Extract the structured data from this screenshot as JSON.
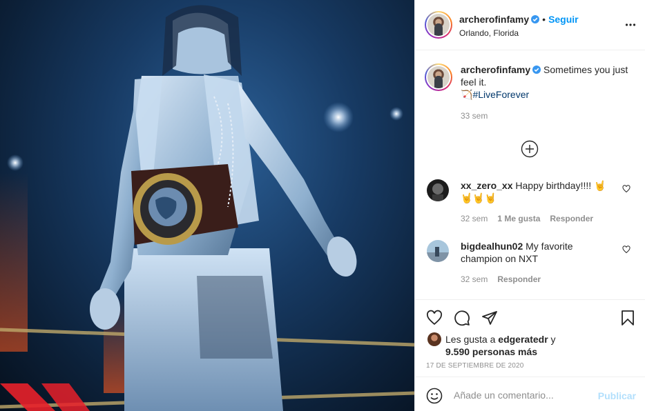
{
  "post": {
    "image_description_icon": "photo-of-wrestler-icon",
    "author": {
      "username": "archerofinfamy",
      "verified_icon": "verified-badge-icon",
      "separator": "•",
      "follow_label": "Seguir",
      "location": "Orlando, Florida"
    },
    "caption": {
      "username": "archerofinfamy",
      "text": "Sometimes you just feel it.",
      "emoji": "🏹",
      "hashtag": "#LiveForever",
      "time": "33 sem"
    },
    "comments": [
      {
        "username": "xx_zero_xx",
        "text": "Happy birthday!!!! 🤘🤘🤘🤘",
        "time": "32 sem",
        "likes": "1 Me gusta",
        "reply": "Responder"
      },
      {
        "username": "bigdealhun02",
        "text": "My favorite champion on NXT",
        "time": "32 sem",
        "reply": "Responder"
      }
    ],
    "likes": {
      "prefix": "Les gusta a",
      "user": "edgeratedr",
      "conjunction": "y",
      "others": "9.590 personas más"
    },
    "date": "17 de septiembre de 2020",
    "add_comment": {
      "placeholder": "Añade un comentario...",
      "publish_label": "Publicar"
    }
  },
  "colors": {
    "accent": "#0095f6",
    "publish_disabled": "#b2dffc",
    "text": "#262626",
    "muted": "#8e8e8e",
    "hashtag": "#00376b"
  }
}
